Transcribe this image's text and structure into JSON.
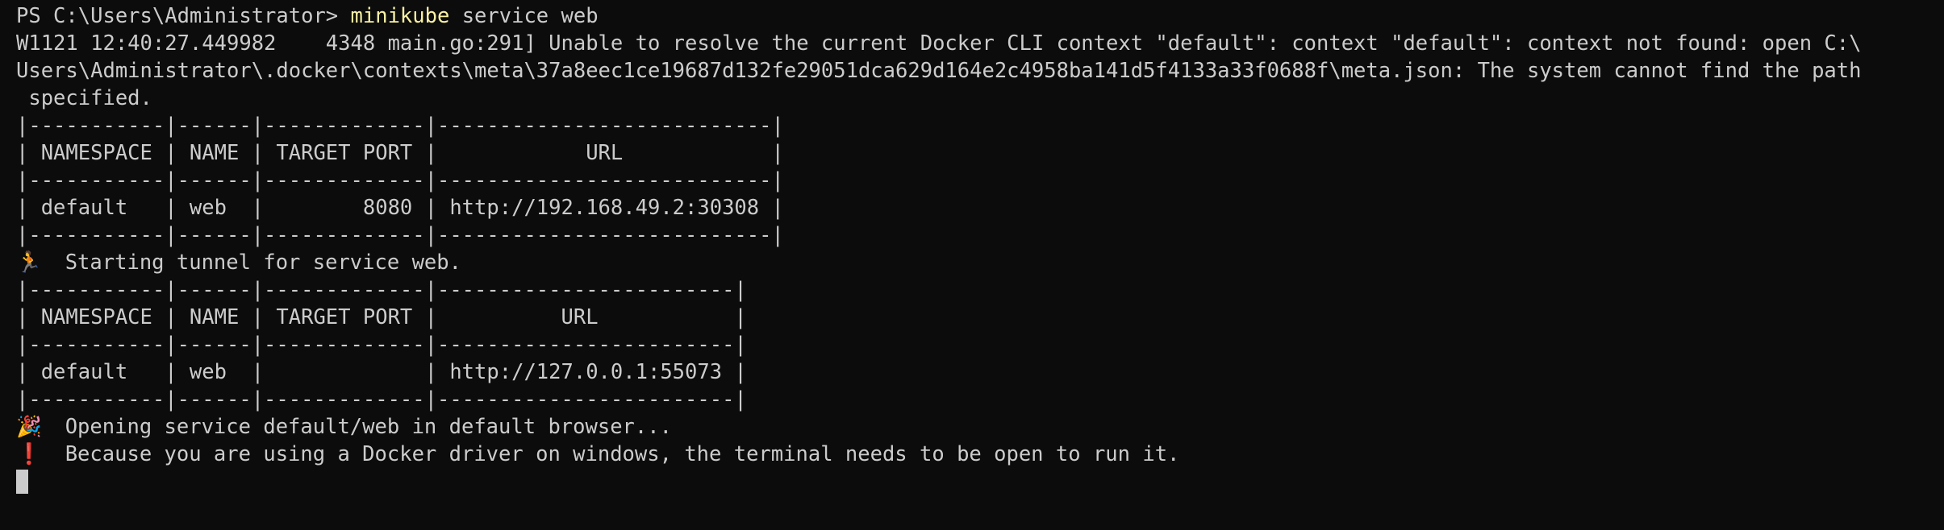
{
  "prompt": {
    "ps_prompt": "PS C:\\Users\\Administrator> ",
    "command": "minikube",
    "args": " service web"
  },
  "warning_lines": [
    "W1121 12:40:27.449982    4348 main.go:291] Unable to resolve the current Docker CLI context \"default\": context \"default\": context not found: open C:\\",
    "Users\\Administrator\\.docker\\contexts\\meta\\37a8eec1ce19687d132fe29051dca629d164e2c4958ba141d5f4133a33f0688f\\meta.json: The system cannot find the path",
    " specified."
  ],
  "table1": [
    "|-----------|------|-------------|---------------------------|",
    "| NAMESPACE | NAME | TARGET PORT |            URL            |",
    "|-----------|------|-------------|---------------------------|",
    "| default   | web  |        8080 | http://192.168.49.2:30308 |",
    "|-----------|------|-------------|---------------------------|"
  ],
  "tunnel": {
    "icon": "🏃",
    "icon_name": "running-person-icon",
    "text": "  Starting tunnel for service web."
  },
  "table2": [
    "|-----------|------|-------------|------------------------|",
    "| NAMESPACE | NAME | TARGET PORT |          URL           |",
    "|-----------|------|-------------|------------------------|",
    "| default   | web  |             | http://127.0.0.1:55073 |",
    "|-----------|------|-------------|------------------------|"
  ],
  "opening": {
    "icon": "🎉",
    "icon_name": "party-popper-icon",
    "text": "  Opening service default/web in default browser..."
  },
  "notice": {
    "icon": "❗",
    "icon_name": "exclamation-icon",
    "text": "  Because you are using a Docker driver on windows, the terminal needs to be open to run it."
  },
  "colors": {
    "background": "#0c0c0c",
    "foreground": "#cccccc",
    "command": "#f9f1a5",
    "warning_icon": "#e74856"
  }
}
